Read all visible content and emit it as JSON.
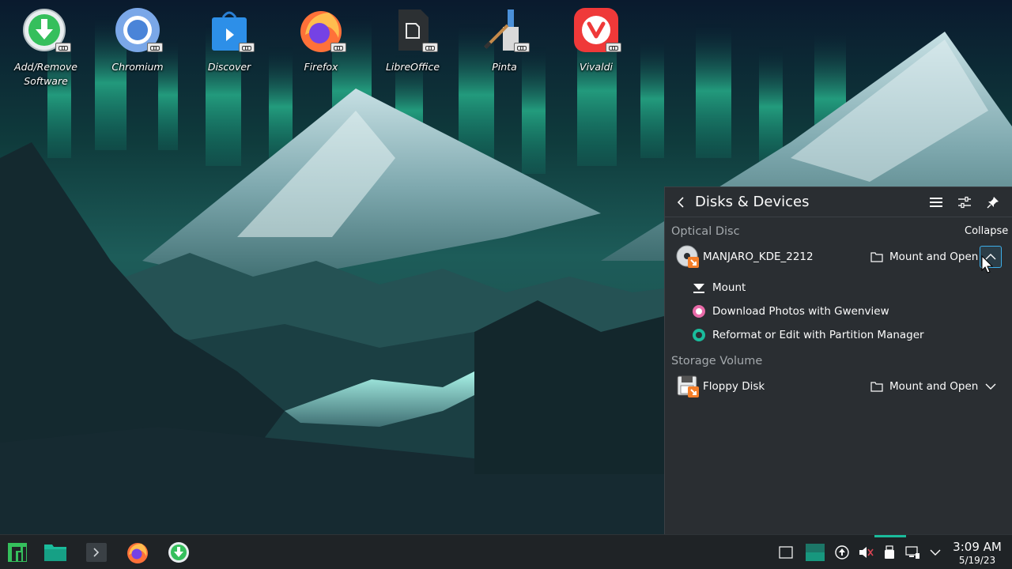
{
  "desktop": {
    "icons": [
      {
        "label": "Add/Remove Software",
        "icon": "package-install-icon"
      },
      {
        "label": "Chromium",
        "icon": "chromium-icon"
      },
      {
        "label": "Discover",
        "icon": "discover-icon"
      },
      {
        "label": "Firefox",
        "icon": "firefox-icon"
      },
      {
        "label": "LibreOffice",
        "icon": "libreoffice-icon"
      },
      {
        "label": "Pinta",
        "icon": "pinta-icon"
      },
      {
        "label": "Vivaldi",
        "icon": "vivaldi-icon"
      }
    ]
  },
  "panel": {
    "title": "Disks & Devices",
    "tooltip": "Collapse",
    "sections": [
      {
        "title": "Optical Disc",
        "device": {
          "name": "MANJARO_KDE_2212",
          "action": "Mount and Open"
        },
        "actions": [
          {
            "label": "Mount",
            "icon": "eject-icon"
          },
          {
            "label": "Download Photos with Gwenview",
            "icon": "gwenview-icon"
          },
          {
            "label": "Reformat or Edit with Partition Manager",
            "icon": "partition-manager-icon"
          }
        ]
      },
      {
        "title": "Storage Volume",
        "device": {
          "name": "Floppy Disk",
          "action": "Mount and Open"
        }
      }
    ]
  },
  "taskbar": {
    "clock_time": "3:09 AM",
    "clock_date": "5/19/23"
  },
  "colors": {
    "accent": "#3daee9",
    "panel_bg": "#2a2e32",
    "taskbar_bg": "#1f2326",
    "manjaro_green": "#35bf5c",
    "active_indicator": "#1abc9c"
  }
}
